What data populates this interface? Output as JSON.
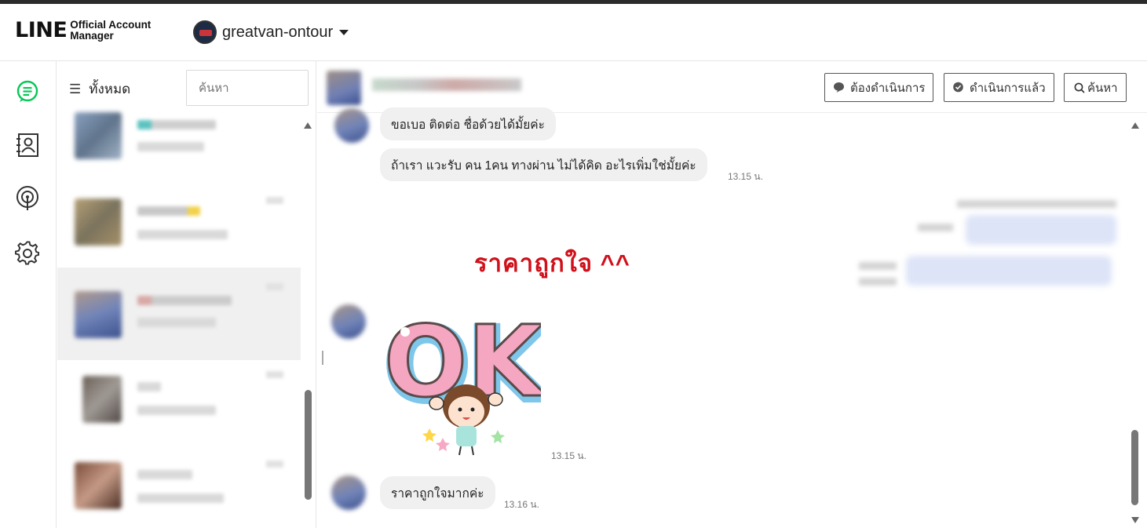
{
  "app": {
    "logo_main": "LINE",
    "logo_sub_line1": "Official Account",
    "logo_sub_line2": "Manager",
    "account_name": "greatvan-ontour"
  },
  "nav": {
    "items": [
      "chat-icon",
      "contacts-icon",
      "broadcast-icon",
      "settings-icon"
    ],
    "accent": "#06c755"
  },
  "list": {
    "filter_label": "ทั้งหมด",
    "search_placeholder": "ค้นหา"
  },
  "chat": {
    "buttons": {
      "pending": "ต้องดำเนินการ",
      "done": "ดำเนินการแล้ว",
      "search": "ค้นหา"
    },
    "messages": {
      "m1": "ขอเบอ ติดต่อ ชื่อด้วยได้มั้ยค่ะ",
      "m2": "ถ้าเรา แวะรับ คน 1คน ทางผ่าน ไม่ได้คิด อะไรเพิ่มใช่มั้ยค่ะ",
      "m2_time": "13.15 น.",
      "sticker_time": "13.15 น.",
      "sticker_text": "OK",
      "m3": "ราคาถูกใจมากค่ะ",
      "m3_time": "13.16 น."
    },
    "overlay_caption": "ราคาถูกใจ ^^"
  }
}
